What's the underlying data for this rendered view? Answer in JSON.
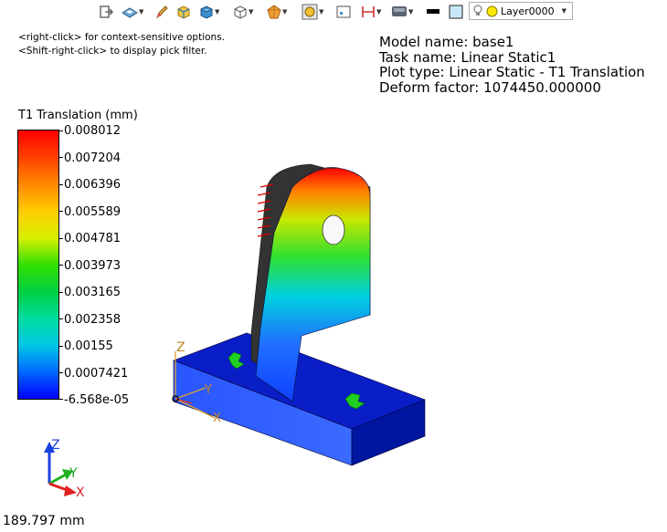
{
  "toolbar": {
    "icons": [
      "exit-icon",
      "view-orient-icon",
      "pencil-icon",
      "shaded-box-icon",
      "solid-cube-icon",
      "wireframe-cube-icon",
      "fringe-icon",
      "select-icon",
      "display-icon",
      "clip-icon",
      "render-icon",
      "color-swatch-icon",
      "background-icon",
      "layer-bulb-icon"
    ],
    "layer": "Layer0000"
  },
  "hints": {
    "line1": "<right-click> for context-sensitive options.",
    "line2": "<Shift-right-click> to display pick filter."
  },
  "model_info": {
    "model_name": "Model name: base1",
    "task_name": "Task name: Linear Static1",
    "plot_type": "Plot type: Linear Static - T1 Translation",
    "deform_factor": "Deform factor: 1074450.000000"
  },
  "legend": {
    "title": "T1 Translation (mm)",
    "labels": [
      "0.008012",
      "0.007204",
      "0.006396",
      "0.005589",
      "0.004781",
      "0.003973",
      "0.003165",
      "0.002358",
      "0.00155",
      "0.0007421",
      "-6.568e-05"
    ],
    "colors": {
      "max": "#ff0000",
      "min": "#0000ff"
    }
  },
  "viewport": {
    "axis_labels": {
      "x": "X",
      "y": "Y",
      "z": "Z"
    }
  },
  "scale": {
    "text": "189.797 mm"
  }
}
